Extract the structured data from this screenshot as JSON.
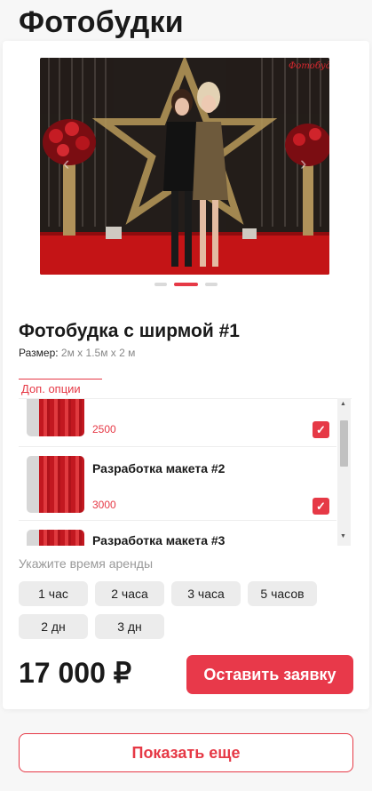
{
  "page": {
    "title": "Фотобудки"
  },
  "gallery": {
    "slides": 3,
    "active_slide": 2,
    "watermark": "Фотобудка"
  },
  "product": {
    "name": "Фотобудка с ширмой #1",
    "size_label": "Размер:",
    "size_value": "2м x 1.5м x 2 м"
  },
  "options": {
    "tab_label": "Доп. опции",
    "items": [
      {
        "name": "",
        "price": "2500",
        "checked": true
      },
      {
        "name": "Разработка макета #2",
        "price": "3000",
        "checked": true
      },
      {
        "name": "Разработка макета #3",
        "price": "",
        "checked": false
      }
    ],
    "scroll_up_icon": "triangle-up",
    "scroll_down_icon": "triangle-down"
  },
  "rent": {
    "label": "Укажите время аренды",
    "durations": [
      "1 час",
      "2 часа",
      "3 часа",
      "5 часов",
      "2 дн",
      "3 дн"
    ]
  },
  "total": {
    "price": "17 000 ₽"
  },
  "buttons": {
    "order": "Оставить заявку",
    "show_more": "Показать еще"
  },
  "colors": {
    "accent": "#e63946",
    "button_bg": "#e8394a"
  }
}
